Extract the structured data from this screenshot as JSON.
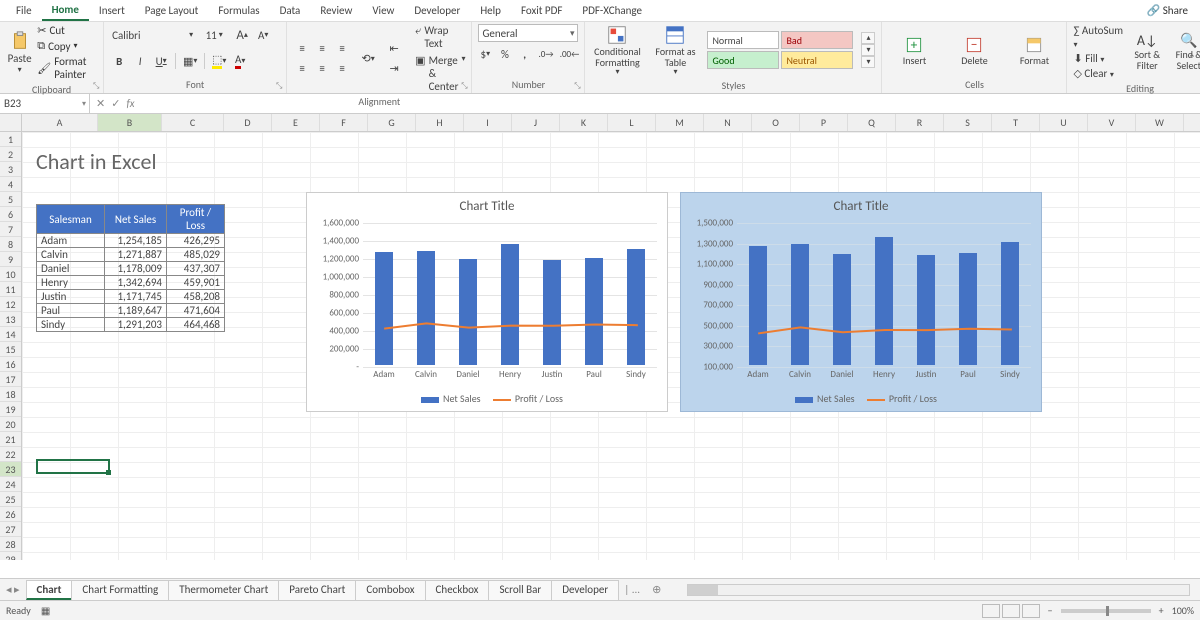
{
  "menutabs": [
    "File",
    "Home",
    "Insert",
    "Page Layout",
    "Formulas",
    "Data",
    "Review",
    "View",
    "Developer",
    "Help",
    "Foxit PDF",
    "PDF-XChange"
  ],
  "active_tab": "Home",
  "share": "Share",
  "clipboard": {
    "paste": "Paste",
    "cut": "Cut",
    "copy": "Copy",
    "painter": "Format Painter",
    "label": "Clipboard"
  },
  "font": {
    "name": "Calibri",
    "size": "11",
    "label": "Font",
    "bold": "B",
    "italic": "I",
    "underline": "U",
    "incA": "A",
    "decA": "A"
  },
  "alignment": {
    "wrap": "Wrap Text",
    "merge": "Merge & Center",
    "label": "Alignment"
  },
  "number": {
    "format": "General",
    "label": "Number",
    "currency": "$",
    "percent": "%",
    "comma": ",",
    "decInc": ".0",
    "decDec": ".00"
  },
  "styles": {
    "cond": "Conditional Formatting",
    "table": "Format as Table",
    "gallery": {
      "normal": "Normal",
      "bad": "Bad",
      "good": "Good",
      "neutral": "Neutral"
    },
    "label": "Styles"
  },
  "cells": {
    "insert": "Insert",
    "delete": "Delete",
    "format": "Format",
    "label": "Cells"
  },
  "editing": {
    "autosum": "AutoSum",
    "fill": "Fill",
    "clear": "Clear",
    "sort": "Sort & Filter",
    "find": "Find & Select",
    "label": "Editing"
  },
  "namebox": "B23",
  "columns": [
    "A",
    "B",
    "C",
    "D",
    "E",
    "F",
    "G",
    "H",
    "I",
    "J",
    "K",
    "L",
    "M",
    "N",
    "O",
    "P",
    "Q",
    "R",
    "S",
    "T",
    "U",
    "V",
    "W"
  ],
  "sheet_title": "Chart in Excel",
  "table": {
    "headers": [
      "Salesman",
      "Net Sales",
      "Profit / Loss"
    ],
    "rows": [
      [
        "Adam",
        "1,254,185",
        "426,295"
      ],
      [
        "Calvin",
        "1,271,887",
        "485,029"
      ],
      [
        "Daniel",
        "1,178,009",
        "437,307"
      ],
      [
        "Henry",
        "1,342,694",
        "459,901"
      ],
      [
        "Justin",
        "1,171,745",
        "458,208"
      ],
      [
        "Paul",
        "1,189,647",
        "471,604"
      ],
      [
        "Sindy",
        "1,291,203",
        "464,468"
      ]
    ]
  },
  "chart_left": {
    "title": "Chart Title",
    "legend_net": "Net Sales",
    "legend_pl": "Profit / Loss",
    "yticks": [
      "1,600,000",
      "1,400,000",
      "1,200,000",
      "1,000,000",
      "800,000",
      "600,000",
      "400,000",
      "200,000",
      "-"
    ]
  },
  "chart_right": {
    "title": "Chart Title",
    "legend_net": "Net Sales",
    "legend_pl": "Profit / Loss",
    "yticks": [
      "1,500,000",
      "1,300,000",
      "1,100,000",
      "900,000",
      "700,000",
      "500,000",
      "300,000",
      "100,000"
    ]
  },
  "sheet_tabs": [
    "Chart",
    "Chart Formatting",
    "Thermometer Chart",
    "Pareto Chart",
    "Combobox",
    "Checkbox",
    "Scroll Bar",
    "Developer"
  ],
  "active_sheet": "Chart",
  "status": {
    "ready": "Ready",
    "zoom": "100%"
  },
  "chart_data": [
    {
      "type": "bar+line",
      "title": "Chart Title",
      "categories": [
        "Adam",
        "Calvin",
        "Daniel",
        "Henry",
        "Justin",
        "Paul",
        "Sindy"
      ],
      "series": [
        {
          "name": "Net Sales",
          "type": "bar",
          "values": [
            1254185,
            1271887,
            1178009,
            1342694,
            1171745,
            1189647,
            1291203
          ]
        },
        {
          "name": "Profit / Loss",
          "type": "line",
          "values": [
            426295,
            485029,
            437307,
            459901,
            458208,
            471604,
            464468
          ]
        }
      ],
      "ylim": [
        0,
        1600000
      ],
      "ytick_step": 200000
    },
    {
      "type": "bar+line",
      "title": "Chart Title",
      "categories": [
        "Adam",
        "Calvin",
        "Daniel",
        "Henry",
        "Justin",
        "Paul",
        "Sindy"
      ],
      "series": [
        {
          "name": "Net Sales",
          "type": "bar",
          "values": [
            1254185,
            1271887,
            1178009,
            1342694,
            1171745,
            1189647,
            1291203
          ]
        },
        {
          "name": "Profit / Loss",
          "type": "line",
          "values": [
            426295,
            485029,
            437307,
            459901,
            458208,
            471604,
            464468
          ]
        }
      ],
      "ylim": [
        100000,
        1500000
      ],
      "ytick_step": 200000
    }
  ]
}
